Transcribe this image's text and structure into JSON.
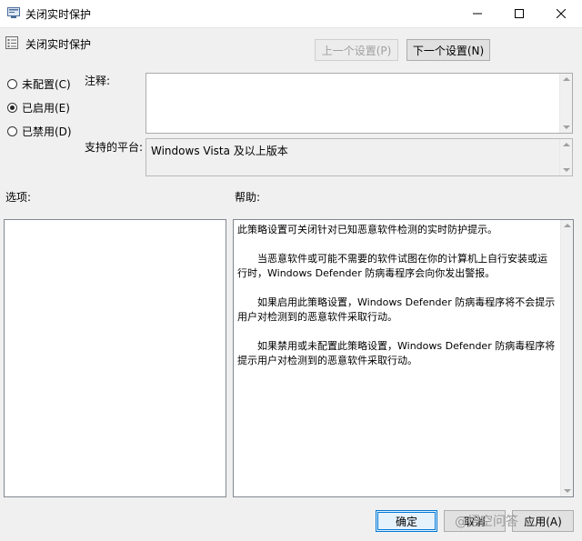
{
  "window": {
    "title": "关闭实时保护",
    "header_title": "关闭实时保护"
  },
  "nav": {
    "prev_label": "上一个设置(P)",
    "next_label": "下一个设置(N)"
  },
  "state": {
    "options": [
      {
        "label": "未配置(C)",
        "checked": false
      },
      {
        "label": "已启用(E)",
        "checked": true
      },
      {
        "label": "已禁用(D)",
        "checked": false
      }
    ]
  },
  "comment": {
    "label": "注释:",
    "value": ""
  },
  "platform": {
    "label": "支持的平台:",
    "value": "Windows Vista 及以上版本"
  },
  "options_section": {
    "label": "选项:"
  },
  "help_section": {
    "label": "帮助:",
    "paragraphs": [
      "此策略设置可关闭针对已知恶意软件检测的实时防护提示。",
      "　　当恶意软件或可能不需要的软件试图在你的计算机上自行安装或运行时，Windows Defender 防病毒程序会向你发出警报。",
      "　　如果启用此策略设置，Windows Defender 防病毒程序将不会提示用户对检测到的恶意软件采取行动。",
      "　　如果禁用或未配置此策略设置，Windows Defender 防病毒程序将提示用户对检测到的恶意软件采取行动。"
    ]
  },
  "footer": {
    "ok_label": "确定",
    "cancel_label": "取消",
    "apply_label": "应用(A)"
  },
  "watermark": {
    "text": "@悟空问答"
  },
  "icons": {
    "app": "policy-icon",
    "minimize": "minimize-icon",
    "maximize": "maximize-icon",
    "close": "close-icon"
  }
}
